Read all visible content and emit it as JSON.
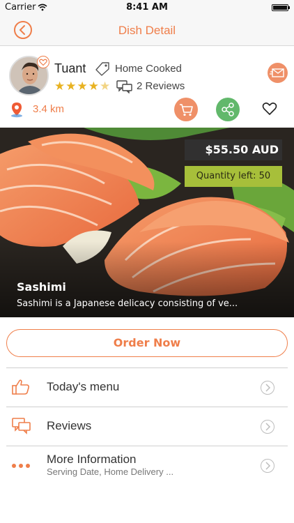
{
  "status_bar": {
    "carrier": "Carrier",
    "time": "8:41 AM",
    "wifi_icon": "wifi-icon",
    "battery_icon": "battery-icon"
  },
  "nav": {
    "title": "Dish Detail",
    "back_icon": "chevron-left-icon"
  },
  "chef": {
    "name": "Tuant",
    "cook_type": "Home Cooked",
    "rating": 4.5,
    "reviews": "2 Reviews",
    "distance": "3.4 km"
  },
  "actions": {
    "message_icon": "envelope-icon",
    "cart_icon": "cart-icon",
    "share_icon": "share-icon",
    "favorite_icon": "heart-icon"
  },
  "dish": {
    "price": "$55.50 AUD",
    "quantity_left": "Quantity left:  50",
    "name": "Sashimi",
    "description": "Sashimi is a Japanese delicacy consisting of ve..."
  },
  "order_button": "Order Now",
  "menu": [
    {
      "label": "Today's menu",
      "icon": "thumbs-up-icon"
    },
    {
      "label": "Reviews",
      "icon": "chat-bubbles-icon"
    },
    {
      "label": "More Information",
      "sublabel": "Serving Date, Home Delivery ...",
      "icon": "more-dots-icon"
    }
  ],
  "colors": {
    "accent": "#ef7e4a",
    "share_green": "#62b86b",
    "quantity_green": "#a7bf3a",
    "star_gold": "#e8b221"
  }
}
